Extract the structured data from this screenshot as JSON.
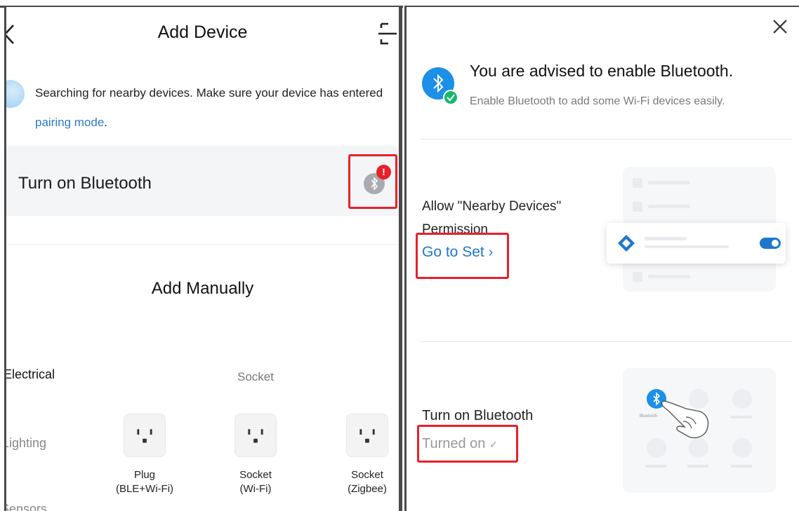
{
  "left": {
    "title": "Add Device",
    "notice_text": "Searching for nearby devices. Make sure your device has entered ",
    "notice_link": "pairing mode",
    "notice_end": ".",
    "bluetooth_row_label": "Turn on Bluetooth",
    "bluetooth_alert": "!",
    "section_title": "Add Manually",
    "categories": [
      "Electrical",
      "Lighting",
      "Sensors"
    ],
    "subcategory": "Socket",
    "devices": [
      {
        "line1": "Plug",
        "line2": "(BLE+Wi-Fi)"
      },
      {
        "line1": "Socket",
        "line2": "(Wi-Fi)"
      },
      {
        "line1": "Socket",
        "line2": "(Zigbee)"
      }
    ]
  },
  "right": {
    "title": "You are advised to enable Bluetooth.",
    "subtitle": "Enable Bluetooth to add some Wi-Fi devices easily.",
    "permission_line1": "Allow \"Nearby Devices\"",
    "permission_line2": "Permission",
    "go_to_set": "Go to Set",
    "bluetooth_label": "Turn on Bluetooth",
    "turned_on": "Turned on",
    "turned_on_check": "✓",
    "illustration_bt_label": "Bluetooth"
  },
  "colors": {
    "accent_blue": "#1e77cf",
    "highlight_red": "#e8202a",
    "bluetooth_blue": "#1c8fe8",
    "check_green": "#17b86b"
  }
}
